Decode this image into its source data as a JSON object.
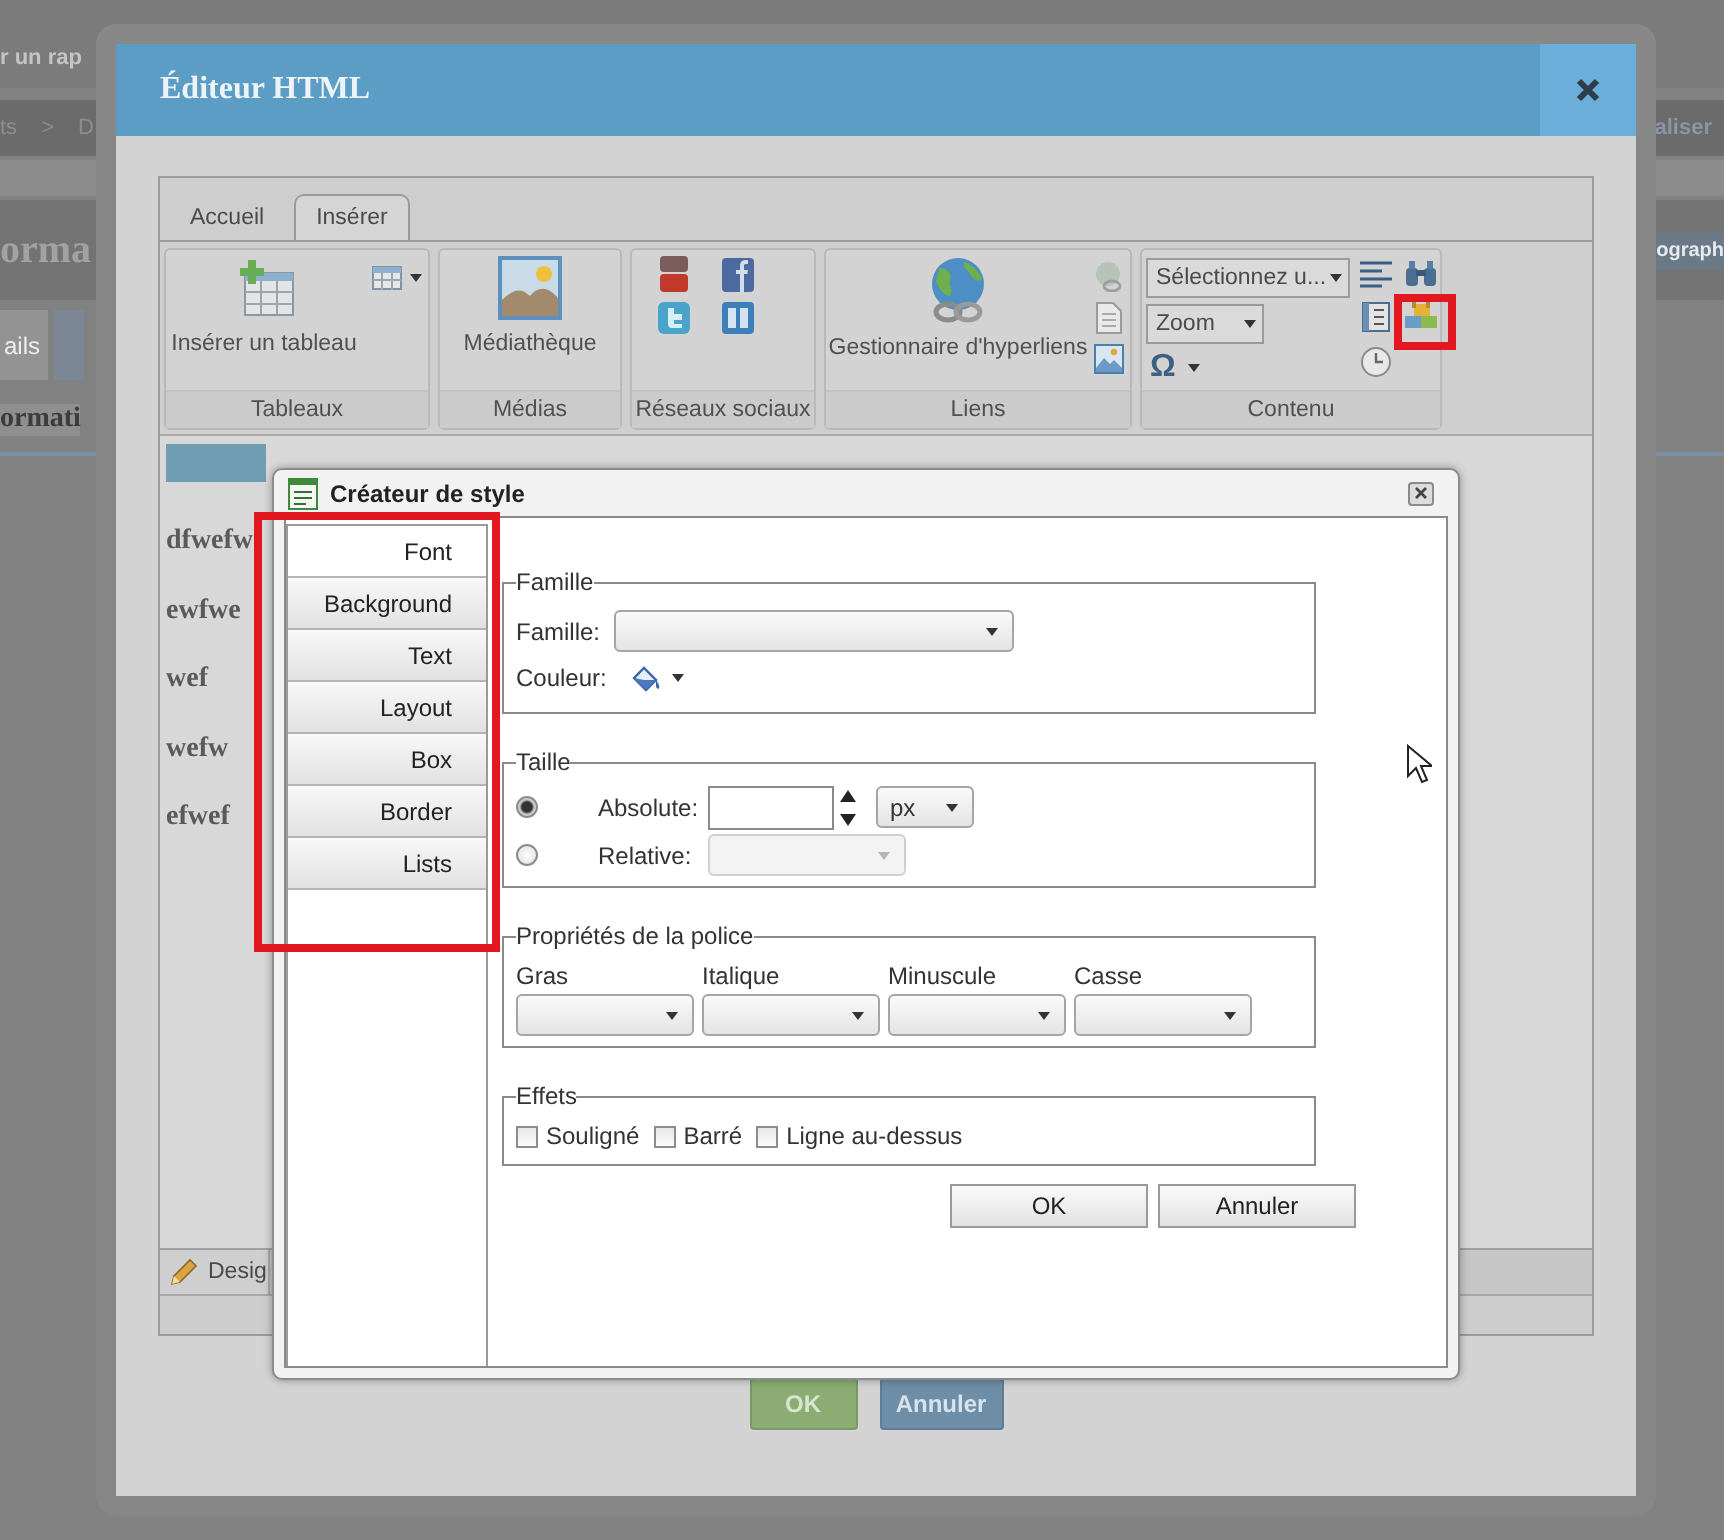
{
  "background_page": {
    "header_text": "r un rap",
    "breadcrumbs": [
      {
        "label": "ts"
      },
      {
        "label": "D"
      }
    ],
    "breadcrumb_separator": ">",
    "header_action": "aliser",
    "page_title": "orma",
    "title_action": "ograph",
    "tabs": [
      {
        "label": "ails",
        "selected": true
      }
    ],
    "section_title": "ormati"
  },
  "editor": {
    "title": "Éditeur HTML",
    "ribbon_tabs": [
      {
        "label": "Accueil",
        "selected": false
      },
      {
        "label": "Insérer",
        "selected": true
      }
    ],
    "ribbon_groups": [
      {
        "kind": "tables",
        "label": "Tableaux",
        "button": "Insérer un tableau"
      },
      {
        "kind": "media",
        "label": "Médias",
        "button": "Médiathèque"
      },
      {
        "kind": "social",
        "label": "Réseaux sociaux"
      },
      {
        "kind": "links",
        "label": "Liens",
        "button": "Gestionnaire d'hyperliens"
      },
      {
        "kind": "content",
        "label": "Contenu",
        "style_select": "Sélectionnez u...",
        "zoom_select": "Zoom",
        "symbol": "Ω"
      }
    ],
    "paragraphs": [
      "dfwefw",
      "ewfwe",
      "wef",
      "wefw",
      "efwef"
    ],
    "mode_tabs": [
      {
        "label": "Desig",
        "selected": true
      }
    ],
    "buttons": [
      {
        "label": "OK",
        "kind": "primary"
      },
      {
        "label": "Annuler",
        "kind": "secondary"
      }
    ]
  },
  "style_dialog": {
    "title": "Créateur de style",
    "categories": [
      {
        "label": "Font",
        "selected": true
      },
      {
        "label": "Background",
        "selected": false
      },
      {
        "label": "Text",
        "selected": false
      },
      {
        "label": "Layout",
        "selected": false
      },
      {
        "label": "Box",
        "selected": false
      },
      {
        "label": "Border",
        "selected": false
      },
      {
        "label": "Lists",
        "selected": false
      }
    ],
    "family_group": {
      "legend": "Famille",
      "family_label": "Famille:",
      "color_label": "Couleur:"
    },
    "size_group": {
      "legend": "Taille",
      "options": [
        {
          "kind": "absolute",
          "label": "Absolute:",
          "selected": true,
          "disabled": false,
          "unit": "px"
        },
        {
          "kind": "relative",
          "label": "Relative:",
          "selected": false,
          "disabled": true
        }
      ]
    },
    "font_group": {
      "legend": "Propriétés de la police",
      "fields": [
        {
          "label": "Gras"
        },
        {
          "label": "Italique"
        },
        {
          "label": "Minuscule"
        },
        {
          "label": "Casse"
        }
      ]
    },
    "effects_group": {
      "legend": "Effets",
      "options": [
        {
          "label": "Souligné",
          "checked": false
        },
        {
          "label": "Barré",
          "checked": false
        },
        {
          "label": "Ligne au-dessus",
          "checked": false
        }
      ]
    },
    "buttons": [
      "OK",
      "Annuler"
    ]
  }
}
